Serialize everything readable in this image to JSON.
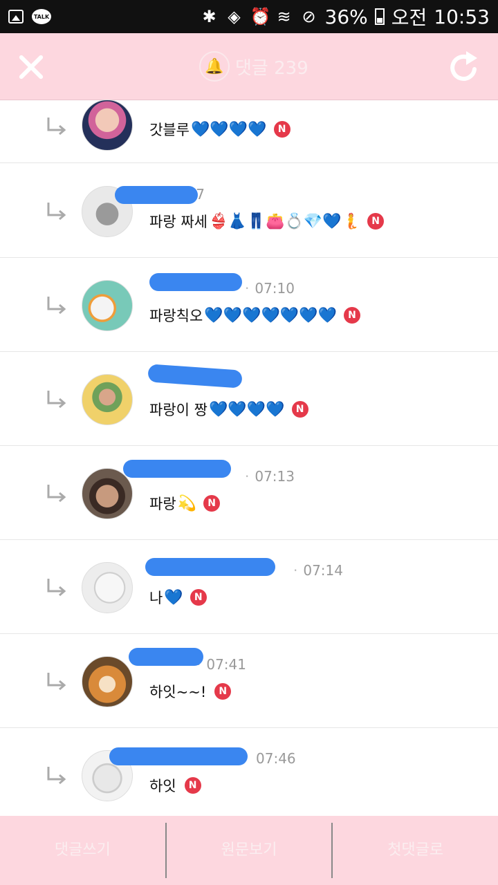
{
  "status_bar": {
    "battery": "36%",
    "ampm": "오전",
    "time": "10:53",
    "talk_icon_text": "TALK",
    "icons": [
      "gallery-icon",
      "kakaotalk-icon",
      "bluetooth-icon",
      "mute-icon",
      "alarm-icon",
      "wifi-icon",
      "do-not-disturb-icon",
      "battery-icon"
    ]
  },
  "header": {
    "title": "댓글 239",
    "icons": [
      "close-icon",
      "bell-icon",
      "refresh-icon"
    ]
  },
  "comments": [
    {
      "time": "",
      "text": "갓블루",
      "hearts": "💙💙💙💙",
      "badge": "N"
    },
    {
      "time": "07:07",
      "text": "파랑 짜세",
      "hearts": "👙👗👖👛💍💎💙🧜",
      "badge": "N"
    },
    {
      "time": "07:10",
      "text": "파랑칙오",
      "hearts": "💙💙💙💙💙💙💙",
      "badge": "N"
    },
    {
      "time": "",
      "text": "파랑이 짱",
      "hearts": "💙💙💙💙",
      "badge": "N"
    },
    {
      "time": "07:13",
      "text": "파랑",
      "hearts": "💫",
      "badge": "N"
    },
    {
      "time": "07:14",
      "text": "나",
      "hearts": "💙",
      "badge": "N"
    },
    {
      "time": "07:41",
      "text": "하잇~~!",
      "hearts": "",
      "badge": "N"
    },
    {
      "time": "07:46",
      "text": "하잇",
      "hearts": "",
      "badge": "N"
    }
  ],
  "bottom_bar": {
    "write": "댓글쓰기",
    "original": "원문보기",
    "first": "첫댓글로"
  },
  "colors": {
    "header_bg": "#fdd7df",
    "redaction": "#3a86f0",
    "heart": "#2da3f0",
    "badge": "#e5394a"
  }
}
